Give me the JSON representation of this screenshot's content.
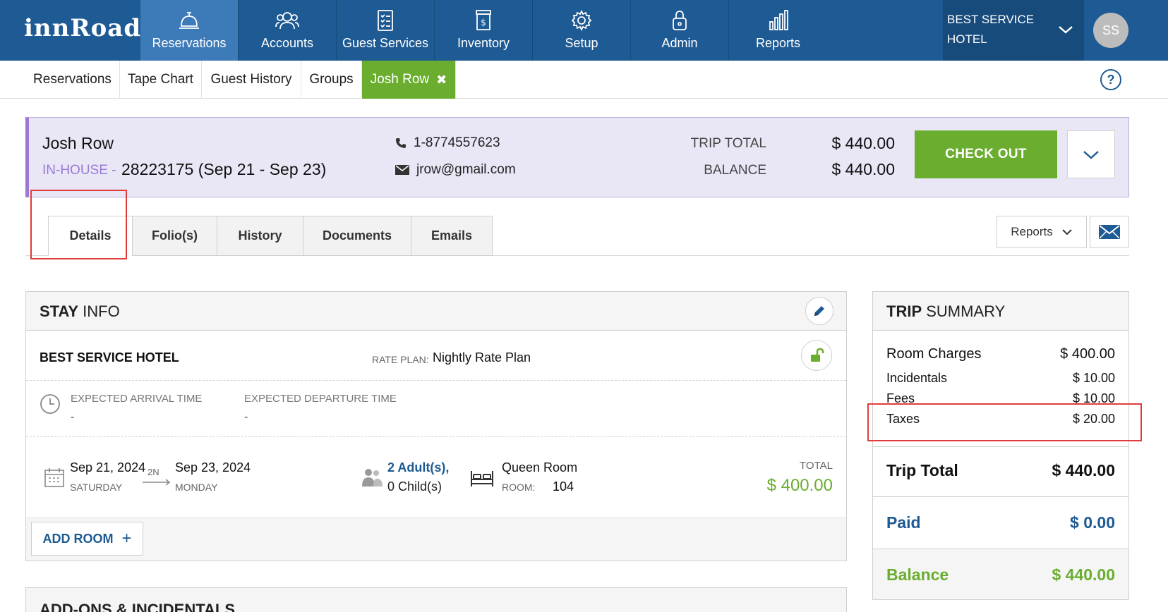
{
  "brand": "innRoad",
  "nav": [
    {
      "label": "Reservations",
      "icon": "bell-icon",
      "active": true
    },
    {
      "label": "Accounts",
      "icon": "users-icon"
    },
    {
      "label": "Guest Services",
      "icon": "checklist-icon"
    },
    {
      "label": "Inventory",
      "icon": "money-jar-icon"
    },
    {
      "label": "Setup",
      "icon": "gear-icon"
    },
    {
      "label": "Admin",
      "icon": "lock-icon"
    },
    {
      "label": "Reports",
      "icon": "bar-chart-icon"
    }
  ],
  "hotel_selector": {
    "line1": "BEST SERVICE",
    "line2": "HOTEL"
  },
  "user_initials": "SS",
  "subnav": [
    {
      "label": "Reservations"
    },
    {
      "label": "Tape Chart"
    },
    {
      "label": "Guest History"
    },
    {
      "label": "Groups"
    },
    {
      "label": "Josh Row",
      "active": true,
      "close": "✖"
    }
  ],
  "help": "?",
  "guest": {
    "name": "Josh Row",
    "status": "IN-HOUSE -",
    "reservation": "28223175 (Sep 21 - Sep 23)",
    "phone": "1-8774557623",
    "email": "jrow@gmail.com",
    "trip_total_label": "TRIP TOTAL",
    "trip_total": "$ 440.00",
    "balance_label": "BALANCE",
    "balance": "$ 440.00",
    "checkout_label": "CHECK OUT"
  },
  "detail_tabs": [
    {
      "label": "Details",
      "active": true
    },
    {
      "label": "Folio(s)"
    },
    {
      "label": "History"
    },
    {
      "label": "Documents"
    },
    {
      "label": "Emails"
    }
  ],
  "reports_label": "Reports",
  "stay_info": {
    "title_bold": "STAY",
    "title_rest": " INFO",
    "hotel": "BEST SERVICE HOTEL",
    "rate_plan_label": "RATE PLAN:",
    "rate_plan": "Nightly Rate Plan",
    "arrival_label": "EXPECTED ARRIVAL TIME",
    "arrival_value": "-",
    "departure_label": "EXPECTED DEPARTURE TIME",
    "departure_value": "-",
    "check_in_date": "Sep 21, 2024",
    "check_in_day": "SATURDAY",
    "nights": "2N",
    "check_out_date": "Sep 23, 2024",
    "check_out_day": "MONDAY",
    "adults": "2 Adult(s),",
    "children": "0 Child(s)",
    "room_type": "Queen Room",
    "room_label": "ROOM:",
    "room_number": "104",
    "total_label": "TOTAL",
    "total_value": "$ 400.00",
    "add_room_label": "ADD ROOM",
    "add_room_plus": "+"
  },
  "addons": {
    "title": "ADD-ONS & INCIDENTALS"
  },
  "trip_summary": {
    "title_bold": "TRIP",
    "title_rest": " SUMMARY",
    "room_charges_label": "Room Charges",
    "room_charges": "$ 400.00",
    "incidentals_label": "Incidentals",
    "incidentals": "$ 10.00",
    "fees_label": "Fees",
    "fees": "$ 10.00",
    "taxes_label": "Taxes",
    "taxes": "$ 20.00",
    "trip_total_label": "Trip Total",
    "trip_total": "$ 440.00",
    "paid_label": "Paid",
    "paid": "$ 0.00",
    "balance_label": "Balance",
    "balance": "$ 440.00"
  },
  "colors": {
    "nav_bg": "#1e5a93",
    "nav_active": "#3d7ab8",
    "accent_green": "#6aad2f",
    "status_purple": "#9a79d6",
    "link_blue": "#1e5a93",
    "annotation_red": "#e23b3b"
  }
}
